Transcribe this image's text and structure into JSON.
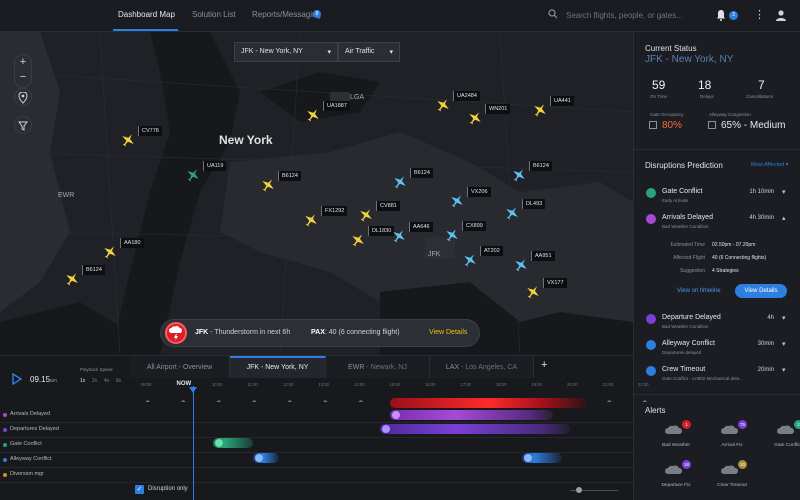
{
  "nav": {
    "tabs": [
      "Dashboard Map",
      "Solution List",
      "Reports/Messaging"
    ],
    "reports_badge": "8",
    "search_placeholder": "Search flights, people, or gates...",
    "notif_count": "3"
  },
  "map": {
    "airport_select": "JFK - New York, NY",
    "layer_select": "Air Traffic",
    "labels": {
      "city": "New York",
      "lga": "LGA",
      "ewr": "EWR",
      "jfk": "JFK"
    },
    "flights": [
      {
        "id": "CV778",
        "color": "yellow"
      },
      {
        "id": "UA1887",
        "color": "yellow"
      },
      {
        "id": "UA2484",
        "color": "yellow"
      },
      {
        "id": "WN201",
        "color": "yellow"
      },
      {
        "id": "UA441",
        "color": "yellow"
      },
      {
        "id": "UA119",
        "color": "green"
      },
      {
        "id": "B6124",
        "color": "yellow"
      },
      {
        "id": "B6124",
        "color": "blue"
      },
      {
        "id": "B6124",
        "color": "blue"
      },
      {
        "id": "FX1292",
        "color": "yellow"
      },
      {
        "id": "CV881",
        "color": "yellow"
      },
      {
        "id": "VX206",
        "color": "blue"
      },
      {
        "id": "DL493",
        "color": "blue"
      },
      {
        "id": "DL1830",
        "color": "yellow"
      },
      {
        "id": "AA646",
        "color": "blue"
      },
      {
        "id": "CX899",
        "color": "blue"
      },
      {
        "id": "AA180",
        "color": "yellow"
      },
      {
        "id": "AT202",
        "color": "blue"
      },
      {
        "id": "AA951",
        "color": "blue"
      },
      {
        "id": "B6124",
        "color": "yellow"
      },
      {
        "id": "VX177",
        "color": "yellow"
      }
    ],
    "alert": {
      "airport": "JFK",
      "message": "- Thunderstorm in next 6h",
      "pax_label": "PAX",
      "pax_value": ": 40 (6 connecting flight)",
      "view": "View Details"
    }
  },
  "status": {
    "title": "Current Status",
    "airport": "JFK - New York, NY",
    "stats": [
      {
        "value": "59",
        "label": "On Time"
      },
      {
        "value": "18",
        "label": "Delays"
      },
      {
        "value": "7",
        "label": "Cancellations"
      }
    ],
    "gate_label": "Gate Occupancy",
    "gate_value": "80%",
    "congestion_label": "Alleyway Congestion",
    "congestion_value": "65% - Medium"
  },
  "disruptions": {
    "title": "Disruptions Prediction",
    "filter": "Most Affected",
    "items": [
      {
        "name": "Gate Conflict",
        "sub": "Early Arrivals",
        "dur": "1h 10min",
        "chev": "▾"
      },
      {
        "name": "Arrivals Delayed",
        "sub": "Bad Weather Condition",
        "dur": "4h 30min",
        "chev": "▴"
      },
      {
        "name": "Departure Delayed",
        "sub": "Bad Weather Condition",
        "dur": "4h",
        "chev": "▾"
      },
      {
        "name": "Alleyway Conflict",
        "sub": "Departures delayed",
        "dur": "30min",
        "chev": "▾"
      },
      {
        "name": "Crew Timeout",
        "sub": "Gate Conflict - AA802 Mechanical dela...",
        "dur": "20min",
        "chev": "▾"
      }
    ],
    "details": [
      {
        "k": "Estimated Time",
        "v": "02.50pm - 07.20pm"
      },
      {
        "k": "Affected Flight",
        "v": "40 (6 Connecting flights)"
      },
      {
        "k": "Suggestion",
        "v": "4 Strategies"
      }
    ],
    "timeline_link": "View on timeline",
    "details_btn": "View Details"
  },
  "alerts": {
    "title": "Alerts",
    "items": [
      {
        "label": "Bad Weather",
        "count": "1",
        "color": "#d81e2c"
      },
      {
        "label": "Arrival Fix",
        "count": "75",
        "color": "#7b3fd6"
      },
      {
        "label": "Gate Conflict",
        "count": "2",
        "color": "#2aa37a"
      },
      {
        "label": "Departure Fix",
        "count": "18",
        "color": "#7b3fd6"
      },
      {
        "label": "Crew Timeout",
        "count": "10",
        "color": "#a8903a"
      }
    ]
  },
  "timeline": {
    "time": "09.15",
    "ampm": "am",
    "playback_label": "Playback Speed",
    "speeds": [
      "1x",
      "2x",
      "4x",
      "8x"
    ],
    "tabs": [
      {
        "label": "All Airport - Overview",
        "dim": ""
      },
      {
        "label": "JFK - New York, NY",
        "dim": ""
      },
      {
        "label": "EWR",
        "dim": " - Newark, NJ"
      },
      {
        "label": "LAX",
        "dim": " - Los Angeles, CA"
      }
    ],
    "ticks": [
      "08:00",
      "NOW",
      "10:00",
      "11:00",
      "12:00",
      "13:00",
      "14:00",
      "15:00",
      "16:00",
      "17:00",
      "18:00",
      "19:00",
      "20:00",
      "21:00",
      "22:00"
    ],
    "rows": [
      {
        "label": "Arrivals Delayed",
        "color": "#a64ad6"
      },
      {
        "label": "Departures Delayed",
        "color": "#7b3fd6"
      },
      {
        "label": "Gate Conflict",
        "color": "#2aa37a"
      },
      {
        "label": "Alleyway Conflict",
        "color": "#2d7fe0"
      },
      {
        "label": "Diversion mgr",
        "color": "#d8902a"
      }
    ],
    "disruption_only": "Disruption only"
  }
}
